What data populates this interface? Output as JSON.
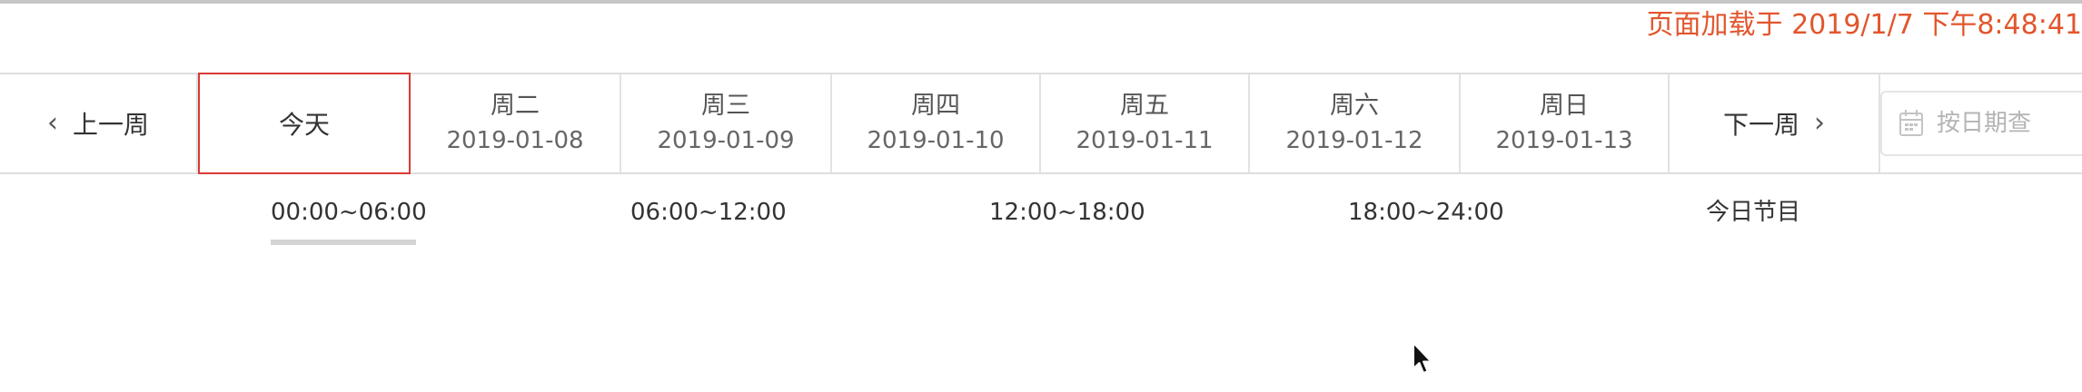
{
  "page_load_time": "页面加载于 2019/1/7 下午8:48:41",
  "week_nav": {
    "prev_label": "上一周",
    "today_label": "今天",
    "next_label": "下一周",
    "days": [
      {
        "name": "周二",
        "date": "2019-01-08"
      },
      {
        "name": "周三",
        "date": "2019-01-09"
      },
      {
        "name": "周四",
        "date": "2019-01-10"
      },
      {
        "name": "周五",
        "date": "2019-01-11"
      },
      {
        "name": "周六",
        "date": "2019-01-12"
      },
      {
        "name": "周日",
        "date": "2019-01-13"
      }
    ]
  },
  "date_search": {
    "placeholder": "按日期查"
  },
  "time_slots": {
    "active_index": 0,
    "items": [
      "00:00~06:00",
      "06:00~12:00",
      "12:00~18:00",
      "18:00~24:00",
      "今日节目"
    ]
  },
  "colors": {
    "accent_red": "#d93a34",
    "load_time_text": "#e2562d",
    "border": "#dedede"
  }
}
